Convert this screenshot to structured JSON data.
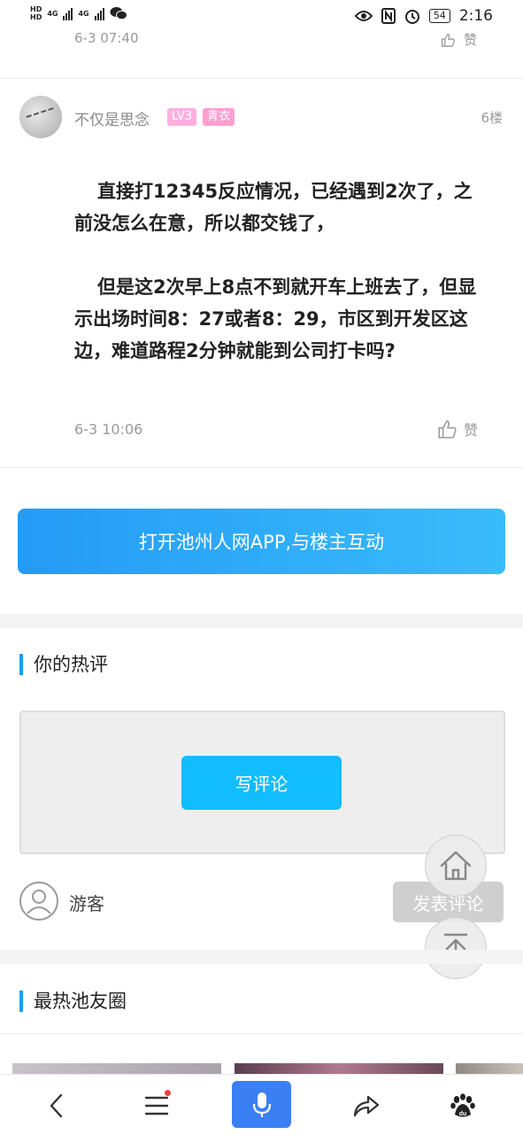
{
  "status_bar": {
    "hd1": "HD",
    "hd2": "HD",
    "net1": "4G",
    "net2": "4G",
    "battery": "54",
    "time": "2:16"
  },
  "prev_post": {
    "time": "6-3 07:40",
    "like_label": "赞"
  },
  "post": {
    "username": "不仅是思念",
    "level_badge": "LV3",
    "title_badge": "青衣",
    "floor": "6楼",
    "paragraphs": [
      "直接打12345反应情况，已经遇到2次了，之前没怎么在意，所以都交钱了，",
      "但是这2次早上8点不到就开车上班去了，但显示出场时间8：27或者8：29，市区到开发区这边，难道路程2分钟就能到公司打卡吗?"
    ],
    "time": "6-3 10:06",
    "like_label": "赞"
  },
  "cta_label": "打开池州人网APP,与楼主互动",
  "hot_comment": {
    "section_title": "你的热评",
    "write_label": "写评论",
    "guest_label": "游客",
    "publish_label": "发表评论"
  },
  "friends_circle": {
    "section_title": "最热池友圈"
  },
  "colors": {
    "accent": "#1aa0f0",
    "cta_start": "#249bf6",
    "cta_end": "#39bcfb",
    "badge_pink": "#ffb0e1",
    "mic_blue": "#3b7ff5"
  },
  "nav": {
    "items": [
      "back-icon",
      "menu-icon",
      "mic-icon",
      "share-icon",
      "baidu-paw-icon"
    ]
  }
}
